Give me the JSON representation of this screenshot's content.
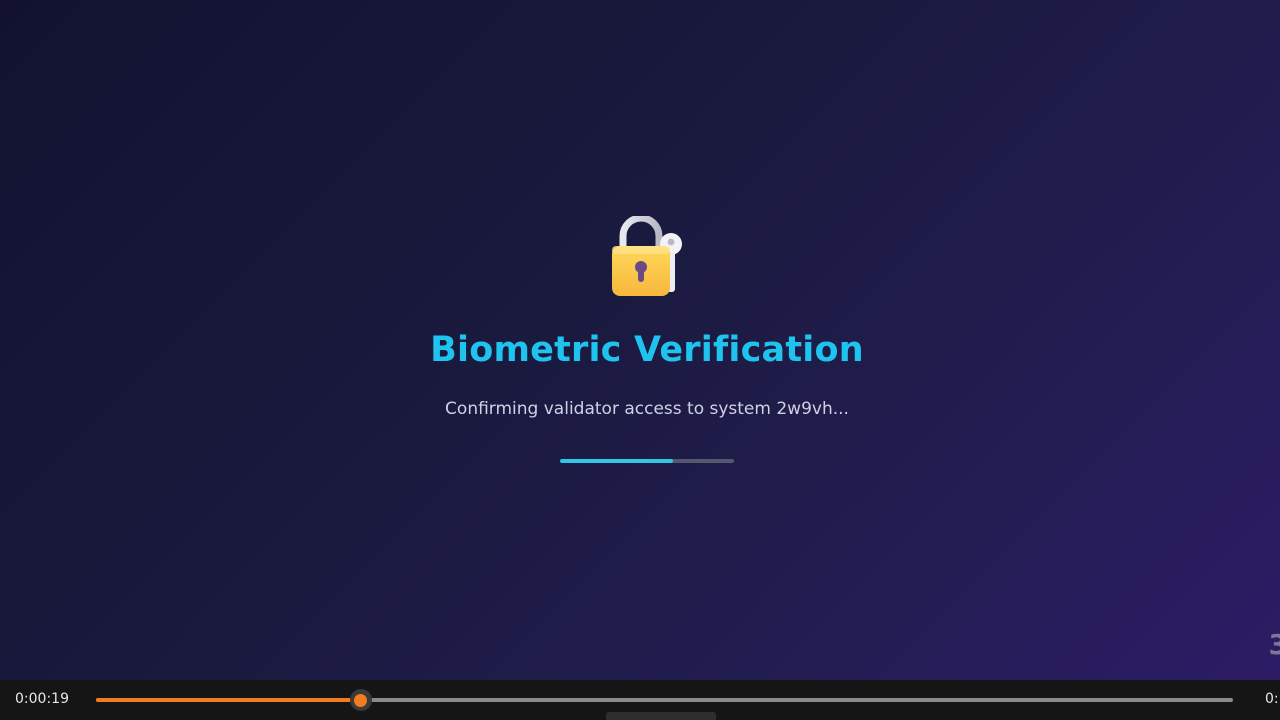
{
  "screen": {
    "icon": "lock-with-key-icon",
    "title": "Biometric Verification",
    "subtitle": "Confirming validator access to system 2w9vh...",
    "progress_fraction": 0.65,
    "corner_number": "3"
  },
  "player": {
    "current_time": "0:00:19",
    "total_time_visible": "0:",
    "seek_fraction": 0.233,
    "accent_color": "#f47b20"
  },
  "colors": {
    "title": "#1ec3ee",
    "loader": "#2ec7e6"
  }
}
